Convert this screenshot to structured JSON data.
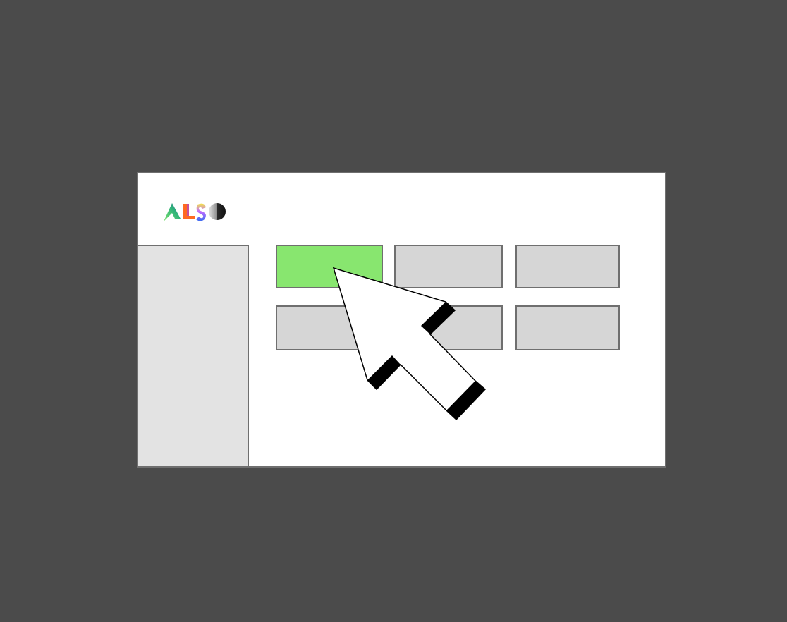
{
  "logo": {
    "letters": [
      "A",
      "L",
      "S",
      "O"
    ],
    "colors": {
      "a_start": "#3fd17a",
      "a_end": "#2f8f6c",
      "l": "#ff6a21",
      "s_top": "#f3e24a",
      "s_bottom": "#3a6cf0",
      "o_dark": "#222222",
      "o_light": "#d0d0d0"
    }
  },
  "window": {
    "background": "#ffffff",
    "border_color": "#6f6f6f"
  },
  "sidebar": {
    "background": "#e3e3e3"
  },
  "grid": {
    "tile_color": "#d6d6d6",
    "active_color": "#88e66f",
    "tiles": [
      {
        "id": "tile-1",
        "active": true
      },
      {
        "id": "tile-2",
        "active": false
      },
      {
        "id": "tile-3",
        "active": false
      },
      {
        "id": "tile-4",
        "active": false
      },
      {
        "id": "tile-5",
        "active": false
      },
      {
        "id": "tile-6",
        "active": false
      }
    ]
  },
  "cursor": {
    "icon": "arrow-cursor-icon",
    "fill": "#ffffff",
    "stripe": "#000000"
  }
}
